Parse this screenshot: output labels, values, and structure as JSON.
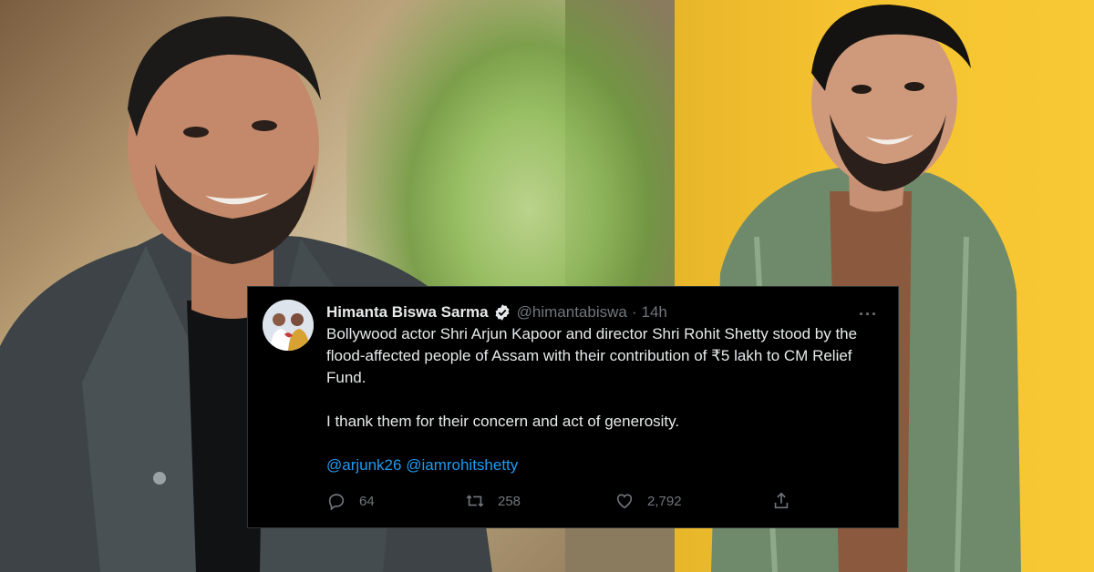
{
  "tweet": {
    "author_name": "Himanta Biswa Sarma",
    "author_handle": "@himantabiswa",
    "separator": "·",
    "time": "14h",
    "more_label": "···",
    "body_paragraph_1": "Bollywood actor Shri Arjun Kapoor and director Shri Rohit Shetty stood by the flood-affected people of Assam with their contribution of ₹5 lakh to CM Relief Fund.",
    "body_paragraph_2": "I thank them for their concern and act of generosity.",
    "mentions": [
      "@arjunk26",
      "@iamrohitshetty"
    ],
    "stats": {
      "replies": "64",
      "retweets": "258",
      "likes": "2,792"
    },
    "icons": {
      "verified": "verified-badge-icon",
      "reply": "reply-icon",
      "retweet": "retweet-icon",
      "like": "heart-icon",
      "share": "share-icon"
    }
  },
  "colors": {
    "tweet_background": "#000000",
    "text_primary": "#e7e9ea",
    "text_secondary": "#71767b",
    "link_blue": "#1d9bf0",
    "background_yellow": "#f5c230"
  }
}
